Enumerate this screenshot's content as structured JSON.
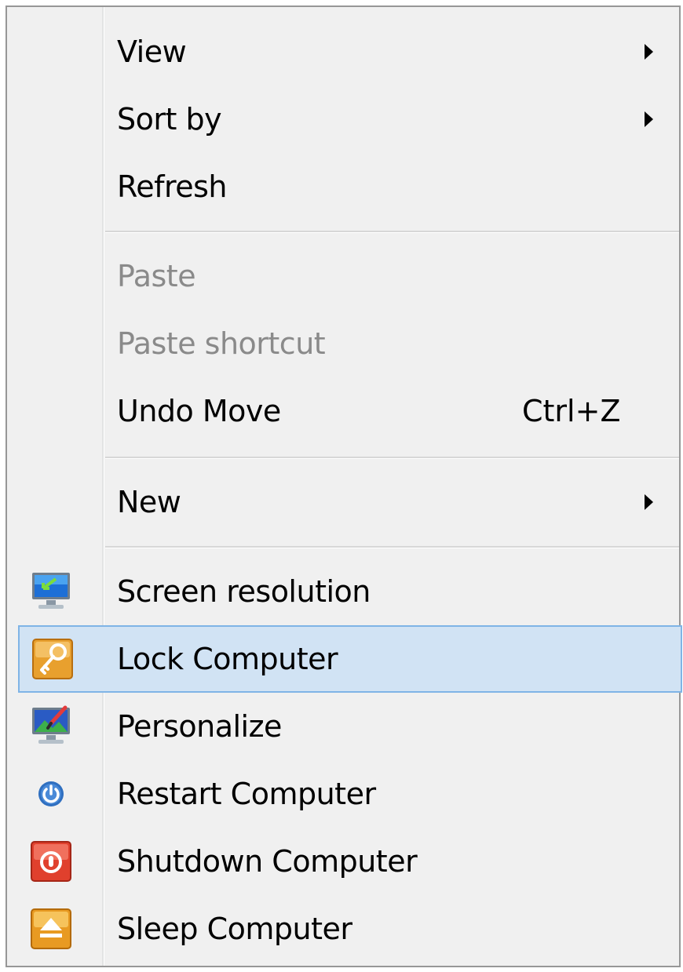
{
  "menu": {
    "items": [
      {
        "label": "View",
        "submenu": true,
        "enabled": true
      },
      {
        "label": "Sort by",
        "submenu": true,
        "enabled": true
      },
      {
        "label": "Refresh",
        "enabled": true
      },
      {
        "label": "Paste",
        "enabled": false
      },
      {
        "label": "Paste shortcut",
        "enabled": false
      },
      {
        "label": "Undo Move",
        "shortcut": "Ctrl+Z",
        "enabled": true
      },
      {
        "label": "New",
        "submenu": true,
        "enabled": true
      },
      {
        "label": "Screen resolution",
        "icon": "screen-resolution-icon",
        "enabled": true
      },
      {
        "label": "Lock Computer",
        "icon": "lock-key-icon",
        "enabled": true,
        "highlighted": true
      },
      {
        "label": "Personalize",
        "icon": "personalize-icon",
        "enabled": true
      },
      {
        "label": "Restart Computer",
        "icon": "restart-power-icon",
        "enabled": true
      },
      {
        "label": "Shutdown Computer",
        "icon": "shutdown-power-icon",
        "enabled": true
      },
      {
        "label": "Sleep Computer",
        "icon": "sleep-eject-icon",
        "enabled": true
      }
    ]
  },
  "colors": {
    "menu_background": "#f0f0f0",
    "highlight_background": "#d1e3f4",
    "highlight_border": "#7fb4e6",
    "disabled_text": "#8a8a8a"
  }
}
